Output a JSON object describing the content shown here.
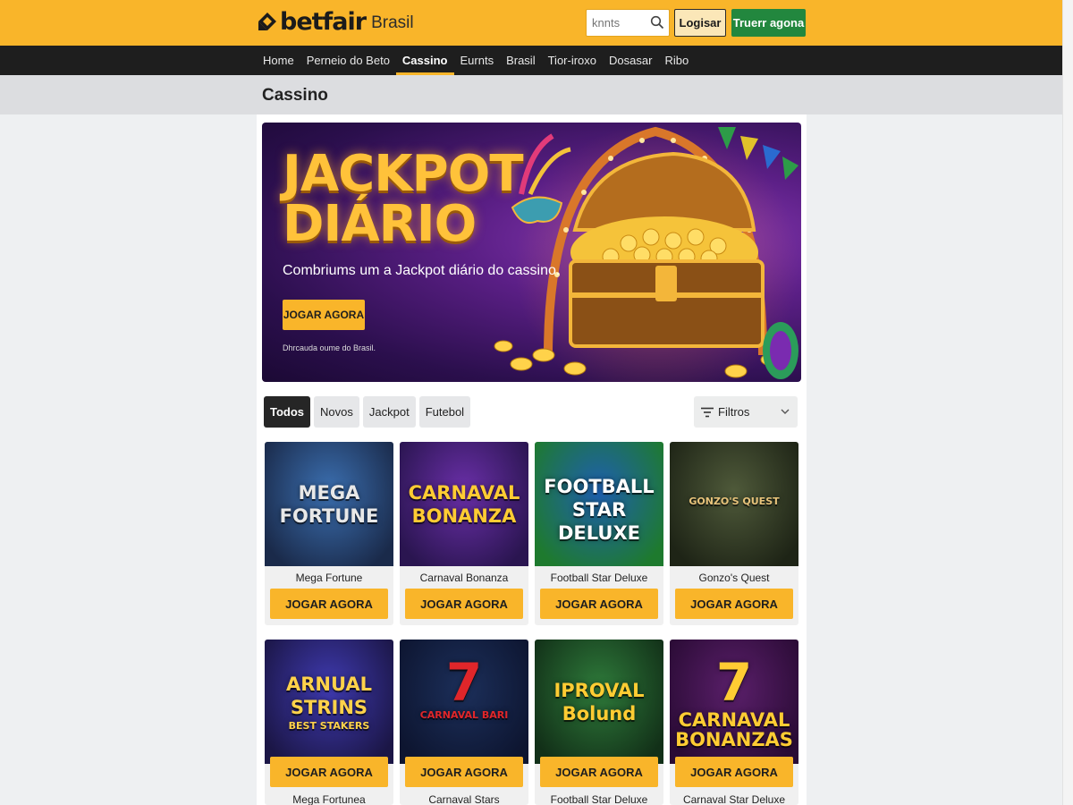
{
  "header": {
    "logo_text": "betfair",
    "logo_sub": "Brasil",
    "search_placeholder": "knnts",
    "login_label": "Logisar",
    "register_label": "Truerr agona"
  },
  "nav": {
    "items": [
      {
        "label": "Home",
        "active": false
      },
      {
        "label": "Perneio do Beto",
        "active": false
      },
      {
        "label": "Cassino",
        "active": true
      },
      {
        "label": "Eurnts",
        "active": false
      },
      {
        "label": "Brasil",
        "active": false
      },
      {
        "label": "Tior-iroxo",
        "active": false
      },
      {
        "label": "Dosasar",
        "active": false
      },
      {
        "label": "Ribo",
        "active": false
      }
    ]
  },
  "page": {
    "title": "Cassino"
  },
  "hero": {
    "title_line1": "JACKPOT",
    "title_line2": "DIÁRIO",
    "subtitle": "Combriums um a Jackpot diário do cassino.",
    "button_label": "JOGAR AGORA",
    "note": "Dhrcauda oume do Brasil."
  },
  "tabs": [
    {
      "label": "Todos",
      "active": true
    },
    {
      "label": "Novos",
      "active": false
    },
    {
      "label": "Jackpot",
      "active": false
    },
    {
      "label": "Futebol",
      "active": false
    }
  ],
  "filters_label": "Filtros",
  "games_row1": [
    {
      "name": "Mega Fortune",
      "art_line1": "MEGA",
      "art_line2": "FORTUNE",
      "button": "JOGAR AGORA",
      "bg1": "#3b6fb0",
      "bg2": "#1a2a4a",
      "fg": "#e8e8e8"
    },
    {
      "name": "Carnaval Bonanza",
      "art_line1": "CARNAVAL",
      "art_line2": "BONANZA",
      "button": "JOGAR AGORA",
      "bg1": "#6a2fa8",
      "bg2": "#2a1550",
      "fg": "#ffcc33"
    },
    {
      "name": "Football Star Deluxe",
      "art_line1": "FOOTBALL",
      "art_line2": "STAR",
      "art_line3": "DELUXE",
      "button": "JOGAR AGORA",
      "bg1": "#1e5fb0",
      "bg2": "#1e7a2e",
      "fg": "#ffffff"
    },
    {
      "name": "Gonzo's Quest",
      "art_line1": "GONZO'S QUEST",
      "art_line2": "",
      "button": "JOGAR AGORA",
      "bg1": "#4f5a3a",
      "bg2": "#1e2416",
      "fg": "#e6c27a"
    }
  ],
  "games_row2": [
    {
      "name": "Mega Fortunea",
      "art_line1": "ARNUAL",
      "art_line2": "STRINS",
      "art_line3": "BEST STAKERS",
      "button": "JOGAR AGORA",
      "bg1": "#3f3ab0",
      "bg2": "#1b1646",
      "fg": "#ffd24a"
    },
    {
      "name": "Carnaval Stars",
      "art_line1": "7",
      "art_line2": "CARNAVAL BARI",
      "button": "JOGAR AGORA",
      "bg1": "#1c2f5a",
      "bg2": "#0d1530",
      "fg": "#e0262a"
    },
    {
      "name": "Football Star Deluxe",
      "art_line1": "IPROVAL",
      "art_line2": "Bolund",
      "button": "JOGAR AGORA",
      "bg1": "#2e7a3a",
      "bg2": "#123018",
      "fg": "#ffcc33"
    },
    {
      "name": "Carnaval Star Deluxe",
      "art_line1": "7",
      "art_line2": "CARNAVAL",
      "art_line3": "BONANZAS",
      "button": "JOGAR AGORA",
      "bg1": "#5a1f6a",
      "bg2": "#2a0b35",
      "fg": "#ffcc33"
    }
  ],
  "colors": {
    "brand": "#f9b52a",
    "nav_bg": "#1e1e1e",
    "register_green": "#22873e"
  }
}
